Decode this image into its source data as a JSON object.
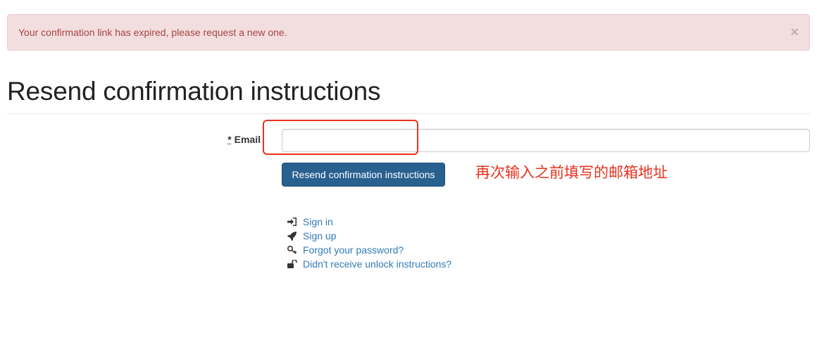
{
  "alert": {
    "message": "Your confirmation link has expired, please request a new one.",
    "close_symbol": "×"
  },
  "page_title": "Resend confirmation instructions",
  "form": {
    "required_marker": "*",
    "email_label": "Email",
    "email_value": "",
    "submit_label": "Resend confirmation instructions"
  },
  "annotation": {
    "text": "再次输入之前填写的邮箱地址",
    "color": "#e8321e"
  },
  "links": [
    {
      "icon": "sign-in-icon",
      "label": "Sign in"
    },
    {
      "icon": "rocket-icon",
      "label": "Sign up"
    },
    {
      "icon": "key-icon",
      "label": "Forgot your password?"
    },
    {
      "icon": "unlock-icon",
      "label": "Didn't receive unlock instructions?"
    }
  ],
  "colors": {
    "alert_bg": "#f2dede",
    "alert_text": "#a94442",
    "button_bg": "#286090",
    "link": "#337ab7"
  }
}
